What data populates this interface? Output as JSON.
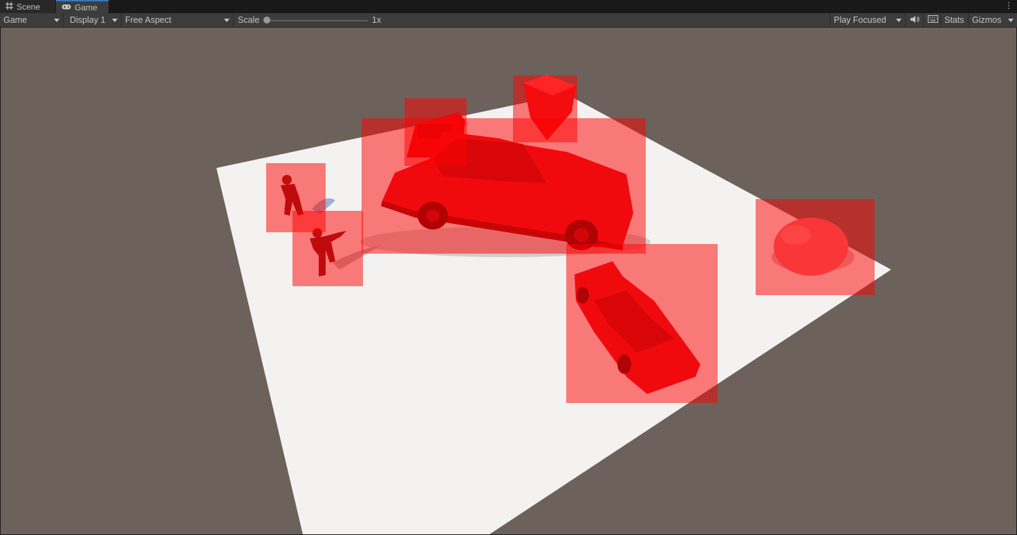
{
  "tabs": {
    "scene_label": "Scene",
    "game_label": "Game"
  },
  "toolbar": {
    "view_mode": "Game",
    "display": "Display 1",
    "aspect": "Free Aspect",
    "scale_label": "Scale",
    "scale_value": "1x",
    "play_mode": "Play Focused",
    "stats_label": "Stats",
    "gizmos_label": "Gizmos"
  },
  "icons": {
    "scene_tab": "grid-icon",
    "game_tab": "gamepad-icon",
    "audio": "speaker-icon",
    "keyboard": "keyboard-icon",
    "menu": "kebab-menu-icon"
  },
  "colors": {
    "highlight": "#ff0000",
    "object": "#e0151b",
    "ground": "#f3f2f1",
    "background": "#6c625b"
  }
}
